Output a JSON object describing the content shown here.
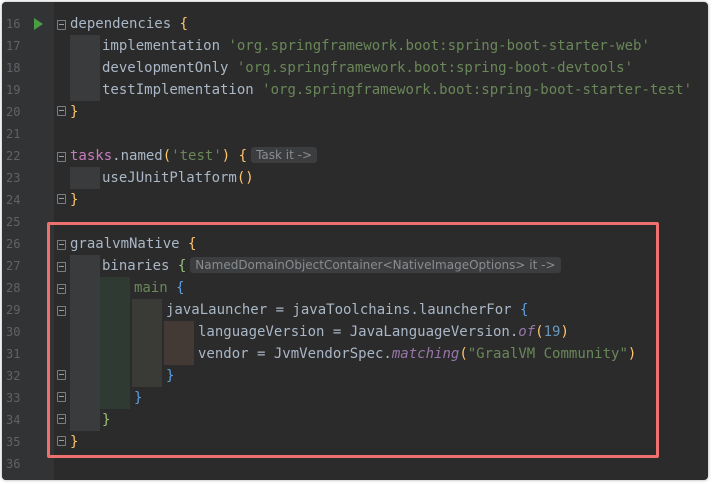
{
  "lines": {
    "l16": {
      "num": "16",
      "a": "dependencies",
      "b": " {"
    },
    "l17": {
      "num": "17",
      "a": "implementation ",
      "s": "'org.springframework.boot:spring-boot-starter-web'"
    },
    "l18": {
      "num": "18",
      "a": "developmentOnly ",
      "s": "'org.springframework.boot:spring-boot-devtools'"
    },
    "l19": {
      "num": "19",
      "a": "testImplementation ",
      "s": "'org.springframework.boot:spring-boot-starter-test'"
    },
    "l20": {
      "num": "20",
      "b": "}"
    },
    "l21": {
      "num": "21"
    },
    "l22": {
      "num": "22",
      "a": "tasks",
      "dot": ".",
      "f": "named",
      "p1": "(",
      "s": "'test'",
      "p2": ")",
      "b": " {",
      "hint": "Task it ->"
    },
    "l23": {
      "num": "23",
      "f": "useJUnitPlatform",
      "p": "()"
    },
    "l24": {
      "num": "24",
      "b": "}"
    },
    "l25": {
      "num": "25"
    },
    "l26": {
      "num": "26",
      "a": "graalvmNative",
      "b": " {"
    },
    "l27": {
      "num": "27",
      "a": "binaries",
      "b": " {",
      "hint": "NamedDomainObjectContainer<NativeImageOptions> it ->"
    },
    "l28": {
      "num": "28",
      "a": "main",
      "b": " {"
    },
    "l29": {
      "num": "29",
      "a": "javaLauncher = javaToolchains.launcherFor ",
      "b": "{"
    },
    "l30": {
      "num": "30",
      "a": "languageVersion = JavaLanguageVersion.",
      "m": "of",
      "p1": "(",
      "n": "19",
      "p2": ")"
    },
    "l31": {
      "num": "31",
      "a": "vendor = JvmVendorSpec.",
      "m": "matching",
      "p1": "(",
      "s": "\"GraalVM Community\"",
      "p2": ")"
    },
    "l32": {
      "num": "32",
      "b": "}"
    },
    "l33": {
      "num": "33",
      "b": "}"
    },
    "l34": {
      "num": "34",
      "b": "}"
    },
    "l35": {
      "num": "35",
      "b": "}"
    },
    "l36": {
      "num": "36"
    }
  },
  "colors": {
    "background": "#2b2b2b",
    "gutter": "#313335",
    "highlight_border": "#f07070",
    "string": "#6a8759",
    "brace": "#ffc66d"
  },
  "icons": {
    "run": "run-triangle-icon",
    "fold": "fold-marker-icon"
  }
}
